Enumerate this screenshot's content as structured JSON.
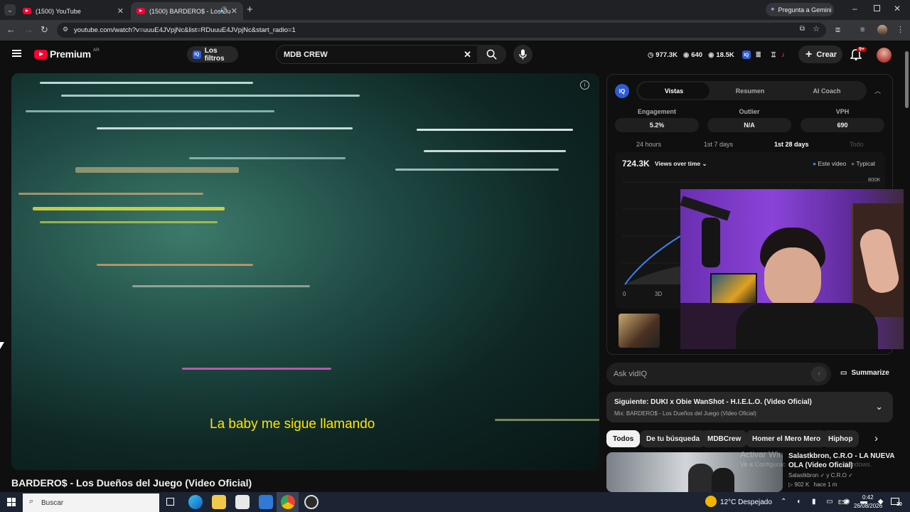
{
  "browser": {
    "tabs": [
      {
        "label": "(1500) YouTube",
        "active": false
      },
      {
        "label": "(1500) BARDERO$ - Los Du",
        "active": true
      }
    ],
    "gemini": "Pregunta a Gemini",
    "url": "youtube.com/watch?v=uuuE4JVpjNc&list=RDuuuE4JVpjNc&start_radio=1"
  },
  "yt": {
    "brand": "Premium",
    "region": "AR",
    "filters": "Los filtros",
    "search": "MDB CREW",
    "stats": {
      "a": "977.3K",
      "b": "640",
      "c": "18.5K"
    },
    "create": "Crear",
    "notif": "9+"
  },
  "video": {
    "subtitle": "La baby me sigue llamando",
    "title": "BARDERO$ - Los Dueños del Juego (Video Oficial)"
  },
  "vidiq": {
    "badge": "IQ",
    "tabs": [
      "Vistas",
      "Resumen",
      "AI Coach"
    ],
    "metrics": [
      {
        "label": "Engagement",
        "value": "5.2%"
      },
      {
        "label": "Outlier",
        "value": "N/A"
      },
      {
        "label": "VPH",
        "value": "690"
      }
    ],
    "ranges": [
      "24 hours",
      "1st 7 days",
      "1st 28 days",
      "Todo"
    ],
    "selected_range": "1st 28 days",
    "views": "724.3K",
    "views_menu": "Views over time",
    "legend": [
      "Este video",
      "Typical"
    ],
    "ymax_label": "800K",
    "x_labels": [
      "0",
      "3D"
    ],
    "ask": "Ask vidIQ",
    "summarize": "Summarize"
  },
  "next": {
    "title": "Siguiente: DUKI x Obie WanShot - H.I.E.L.O. (Video Oficial)",
    "subtitle": "Mix: BARDERO$ - Los Dueños del Juego (Video Oficial)"
  },
  "chips": [
    "Todos",
    "De tu búsqueda",
    "MDBCrew",
    "Homer el Mero Mero",
    "Hiphop"
  ],
  "rec": {
    "title_line1": "Salastkbron, C.R.O - LA NUEVA",
    "title_line2": "OLA (Video Oficial)",
    "channel": "Salastkbron",
    "channel2": "y C.R.O",
    "views": "902 K",
    "age": "hace 1 m"
  },
  "watermark": {
    "line1": "Activar Win",
    "line2": "Ve a Configurac",
    "line3": "Windows."
  },
  "taskbar": {
    "search": "Buscar",
    "weather": "12°C  Despejado",
    "lang": "ESP",
    "time": "0:42",
    "date": "26/08/2026",
    "notif_count": "10"
  },
  "chart_data": {
    "type": "line",
    "title": "Views over time",
    "x_labels": [
      "0",
      "3D"
    ],
    "y_max_label": "800K",
    "series": [
      {
        "name": "Este video"
      },
      {
        "name": "Typical"
      }
    ]
  }
}
